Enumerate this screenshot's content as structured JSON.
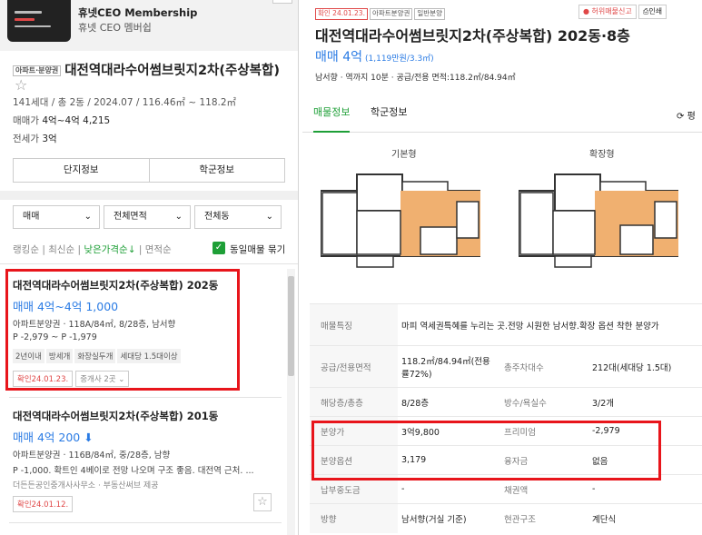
{
  "banner": {
    "title": "휴넷CEO Membership",
    "subtitle": "휴넷 CEO 멤버쉽"
  },
  "left": {
    "tag": "아파트·분양권",
    "title": "대전역대라수어썸브릿지2차(주상복합)",
    "meta": "141세대 / 총 2동 / 2024.07 / 116.46㎡ ~ 118.2㎡",
    "sale_label": "매매가",
    "sale_value": "4억~4억 4,215",
    "jeonse_label": "전세가",
    "jeonse_value": "3억",
    "btn_info": "단지정보",
    "btn_school": "학군정보",
    "filters": [
      "매매",
      "전체면적",
      "전체동"
    ],
    "sorts": [
      "랭킹순",
      "최신순",
      "낮은가격순↓",
      "면적순"
    ],
    "same_label": "동일매물 묶기",
    "cards": [
      {
        "title": "대전역대라수어썸브릿지2차(주상복합) 202동",
        "price": "매매 4억~4억 1,000",
        "line1": "아파트분양권 · 118A/84㎡, 8/28층, 남서향",
        "line2": "P -2,979 ~ P -1,979",
        "chips": [
          "2년이내",
          "방세개",
          "화장실두개",
          "세대당 1.5대이상"
        ],
        "confirm": "확인24.01.23.",
        "agent": "중개사 2곳"
      },
      {
        "title": "대전역대라수어썸브릿지2차(주상복합) 201동",
        "price": "매매 4억 200",
        "line1": "아파트분양권 · 116B/84㎡, 중/28층, 남향",
        "line2": "P -1,000. 확트인 4베이로 전망 나오며 구조 좋음. 대전역 근처. ...",
        "source": "더든든공인중개사사무소 · 부동산써브 제공",
        "confirm": "확인24.01.12."
      }
    ]
  },
  "right": {
    "tags": [
      "확인 24.01.23.",
      "아파트분양권",
      "일반분양"
    ],
    "btn_report": "허위매물신고",
    "btn_print": "인쇄",
    "title": "대전역대라수어썸브릿지2차(주상복합) 202동·8층",
    "price": "매매 4억",
    "price_sub": "(1,119만원/3.3㎡)",
    "summary": "남서향 · 역까지 10분 · 공급/전용 면적:118.2㎡/84.94㎡",
    "tabs": [
      "매물정보",
      "학군정보"
    ],
    "refresh": "평",
    "plan_basic": "기본형",
    "plan_ext": "확장형",
    "rows": [
      {
        "k1": "매물특징",
        "v1": "마피 역세권특혜를 누리는 곳.전망 시원한 남서향.확장 옵션 착한 분양가"
      },
      {
        "k1": "공급/전용면적",
        "v1": "118.2㎡/84.94㎡(전용률72%)",
        "k2": "총주차대수",
        "v2": "212대(세대당 1.5대)"
      },
      {
        "k1": "해당층/총층",
        "v1": "8/28층",
        "k2": "방수/욕실수",
        "v2": "3/2개"
      },
      {
        "k1": "분양가",
        "v1": "3억9,800",
        "k2": "프리미엄",
        "v2": "-2,979"
      },
      {
        "k1": "분양옵션",
        "v1": "3,179",
        "k2": "융자금",
        "v2": "없음"
      },
      {
        "k1": "납부중도금",
        "v1": "-",
        "k2": "채권액",
        "v2": "-"
      },
      {
        "k1": "방향",
        "v1": "남서향(거실 기준)",
        "k2": "현관구조",
        "v2": "계단식"
      }
    ]
  },
  "colors": {
    "accent_green": "#1e9f37",
    "price_blue": "#2a7be4",
    "highlight_red": "#e8151b"
  }
}
